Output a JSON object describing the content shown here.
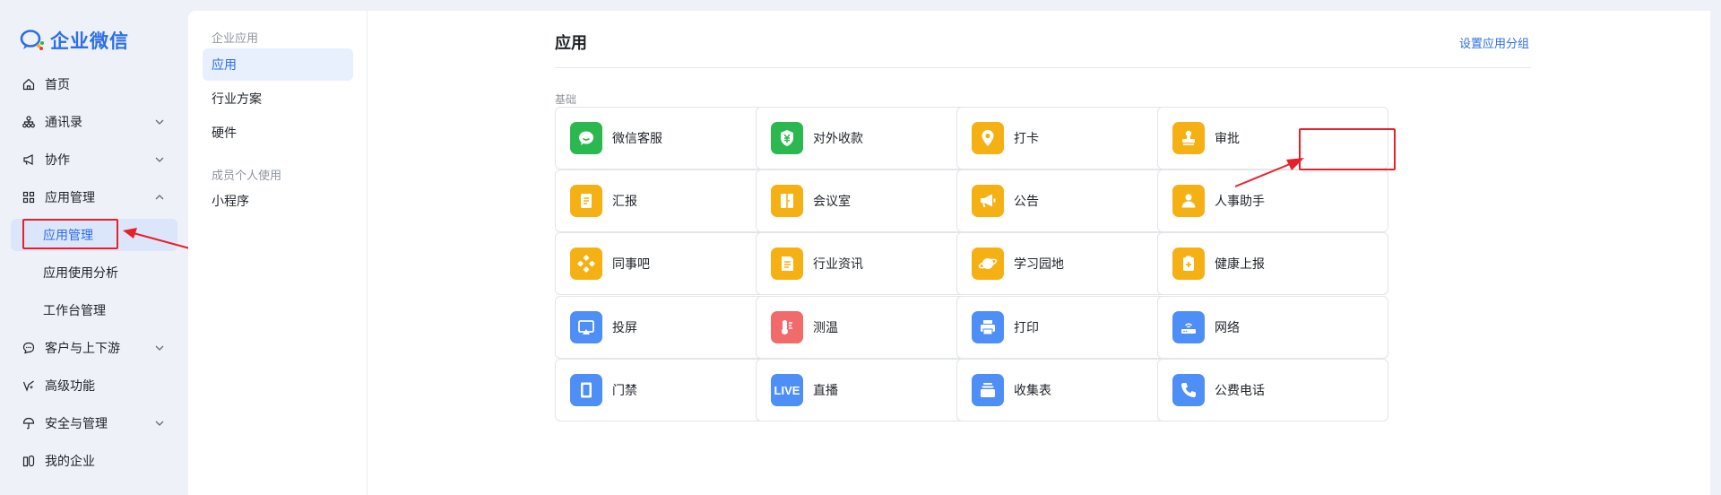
{
  "brand": {
    "name": "企业微信",
    "accent": "#2a6ee8"
  },
  "sidebar": {
    "items": [
      {
        "label": "首页",
        "icon": "home-icon",
        "expandable": false
      },
      {
        "label": "通讯录",
        "icon": "org-chart-icon",
        "expandable": true
      },
      {
        "label": "协作",
        "icon": "megaphone-icon",
        "expandable": true
      },
      {
        "label": "应用管理",
        "icon": "grid-icon",
        "expandable": true,
        "expanded": true
      },
      {
        "label": "客户与上下游",
        "icon": "chat-bubble-icon",
        "expandable": true
      },
      {
        "label": "高级功能",
        "icon": "sparkle-icon",
        "expandable": false
      },
      {
        "label": "安全与管理",
        "icon": "umbrella-icon",
        "expandable": true
      },
      {
        "label": "我的企业",
        "icon": "building-icon",
        "expandable": false
      }
    ],
    "subitems": [
      {
        "label": "应用管理",
        "active": true
      },
      {
        "label": "应用使用分析",
        "active": false
      },
      {
        "label": "工作台管理",
        "active": false
      }
    ]
  },
  "panel2": {
    "group1": "企业应用",
    "group1_items": [
      "应用",
      "行业方案",
      "硬件"
    ],
    "group2": "成员个人使用",
    "group2_items": [
      "小程序"
    ]
  },
  "main": {
    "title": "应用",
    "set_group_link": "设置应用分组",
    "section": "基础",
    "apps": [
      {
        "name": "微信客服",
        "icon": "wechat-service-icon",
        "color": "#2bb84f"
      },
      {
        "name": "对外收款",
        "icon": "yuan-shield-icon",
        "color": "#2bb84f"
      },
      {
        "name": "打卡",
        "icon": "location-pin-icon",
        "color": "#f5b014"
      },
      {
        "name": "审批",
        "icon": "stamp-icon",
        "color": "#f5b014"
      },
      {
        "name": "汇报",
        "icon": "report-icon",
        "color": "#f5b014"
      },
      {
        "name": "会议室",
        "icon": "door-icon",
        "color": "#f5b014"
      },
      {
        "name": "公告",
        "icon": "megaphone-icon",
        "color": "#f5b014"
      },
      {
        "name": "人事助手",
        "icon": "person-icon",
        "color": "#f5b014"
      },
      {
        "name": "同事吧",
        "icon": "network-icon",
        "color": "#f5b014"
      },
      {
        "name": "行业资讯",
        "icon": "news-icon",
        "color": "#f5b014"
      },
      {
        "name": "学习园地",
        "icon": "planet-icon",
        "color": "#f5b014"
      },
      {
        "name": "健康上报",
        "icon": "health-clipboard-icon",
        "color": "#f5b014"
      },
      {
        "name": "投屏",
        "icon": "screencast-icon",
        "color": "#4e8ef7"
      },
      {
        "name": "测温",
        "icon": "thermometer-icon",
        "color": "#f26b6b"
      },
      {
        "name": "打印",
        "icon": "printer-icon",
        "color": "#4e8ef7"
      },
      {
        "name": "网络",
        "icon": "router-icon",
        "color": "#4e8ef7"
      },
      {
        "name": "门禁",
        "icon": "door-access-icon",
        "color": "#4e8ef7"
      },
      {
        "name": "直播",
        "icon": "live-icon",
        "color": "#4e8ef7",
        "badge": "LIVE"
      },
      {
        "name": "收集表",
        "icon": "tray-icon",
        "color": "#4e8ef7"
      },
      {
        "name": "公费电话",
        "icon": "phone-icon",
        "color": "#4e8ef7"
      }
    ]
  },
  "annotation": {
    "color": "#e8202a"
  }
}
